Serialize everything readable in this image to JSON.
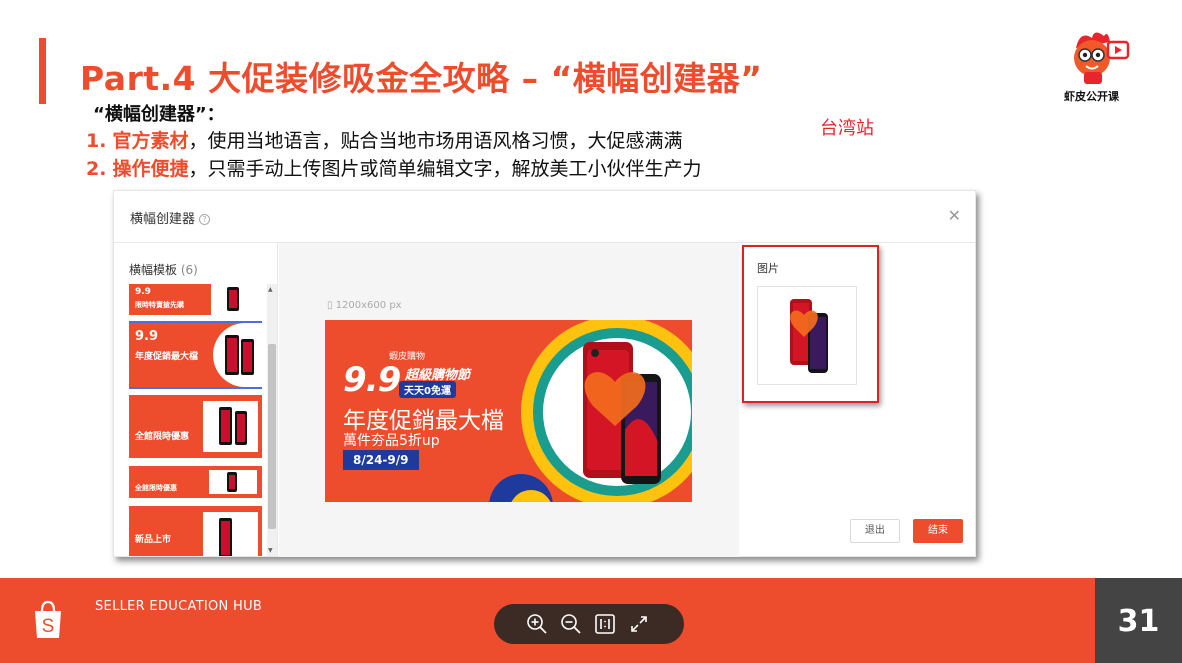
{
  "slide": {
    "title": "Part.4 大促装修吸金全攻略 – “横幅创建器”",
    "subtitle": "“横幅创建器”：",
    "bullets": [
      {
        "num": "1.",
        "highlight": "官方素材",
        "text": "，使用当地语言，贴合当地市场用语风格习惯，大促感满满"
      },
      {
        "num": "2.",
        "highlight": "操作便捷",
        "text": "，只需手动上传图片或简单编辑文字，解放美工小伙伴生产力"
      }
    ],
    "region_label": "台湾站",
    "brand_caption": "虾皮公开课"
  },
  "dialog": {
    "title": "横幅创建器",
    "templates_heading": "横幅模板",
    "templates_count": "(6)",
    "canvas_size": "1200x600 px",
    "image_label": "图片",
    "exit_label": "退出",
    "finish_label": "结束"
  },
  "templates": [
    {
      "text": "限時特賣搶先購"
    },
    {
      "text": "年度促銷最大檔"
    },
    {
      "text": "全館限時優惠"
    },
    {
      "text": "全館限時優惠"
    },
    {
      "text": "新品上市"
    }
  ],
  "banner": {
    "brand": "蝦皮購物",
    "big_number": "9.9",
    "festival": "超級購物節",
    "free_shipping": "天天0免運",
    "headline": "年度促銷最大檔",
    "subline": "萬件夯品5折up",
    "dates": "8/24-9/9"
  },
  "footer": {
    "hub_label": "SELLER EDUCATION HUB",
    "page_number": "31"
  },
  "colors": {
    "accent": "#ee4d2d",
    "highlight_box": "#dd2222",
    "page_box": "#444444",
    "viewer_bar": "#3c2a24",
    "banner_navy": "#1e3a9c",
    "banner_yellow": "#ffc20e",
    "banner_teal": "#1a9c8e"
  },
  "icons": {
    "help": "question-circle-icon",
    "close": "close-icon",
    "zoom_in": "zoom-in-icon",
    "zoom_out": "zoom-out-icon",
    "actual_size": "actual-size-icon",
    "fullscreen": "fullscreen-icon",
    "shop_bag": "shopee-bag-icon",
    "mascot": "shrimp-mascot-icon"
  }
}
